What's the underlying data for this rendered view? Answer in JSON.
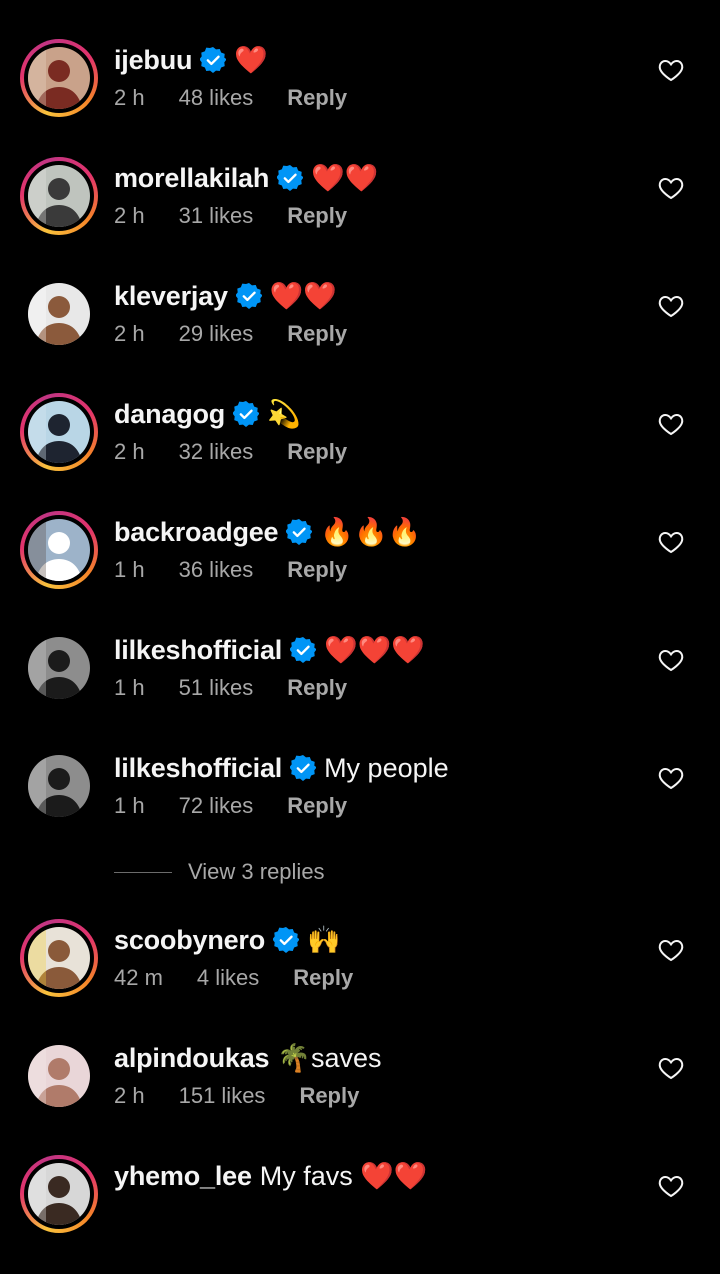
{
  "comments": [
    {
      "username": "ijebuu",
      "verified": true,
      "text": "❤️",
      "time": "2 h",
      "likes": "48 likes",
      "reply": "Reply",
      "story_ring": true,
      "avatar_colors": [
        "#c9a28a",
        "#7a2b22",
        "#e8d7c4"
      ]
    },
    {
      "username": "morellakilah",
      "verified": true,
      "text": "❤️❤️",
      "time": "2 h",
      "likes": "31 likes",
      "reply": "Reply",
      "story_ring": true,
      "avatar_colors": [
        "#bfc4be",
        "#3a3a3a",
        "#e6e6e2"
      ]
    },
    {
      "username": "kleverjay",
      "verified": true,
      "text": "❤️❤️",
      "time": "2 h",
      "likes": "29 likes",
      "reply": "Reply",
      "story_ring": false,
      "avatar_colors": [
        "#e8e8e8",
        "#8b5a3c",
        "#ffffff"
      ]
    },
    {
      "username": "danagog",
      "verified": true,
      "text": "💫",
      "time": "2 h",
      "likes": "32 likes",
      "reply": "Reply",
      "story_ring": true,
      "avatar_colors": [
        "#b9d6e6",
        "#1e2430",
        "#dbe9f2"
      ]
    },
    {
      "username": "backroadgee",
      "verified": true,
      "text": "🔥🔥🔥",
      "time": "1 h",
      "likes": "36 likes",
      "reply": "Reply",
      "story_ring": true,
      "avatar_colors": [
        "#9db3c9",
        "#ffffff",
        "#5b4c44"
      ]
    },
    {
      "username": "lilkeshofficial",
      "verified": true,
      "text": "❤️❤️❤️",
      "time": "1 h",
      "likes": "51 likes",
      "reply": "Reply",
      "story_ring": false,
      "avatar_colors": [
        "#8d8d8d",
        "#1b1b1b",
        "#cfcfcf"
      ]
    },
    {
      "username": "lilkeshofficial",
      "verified": true,
      "text": "My people",
      "time": "1 h",
      "likes": "72 likes",
      "reply": "Reply",
      "story_ring": false,
      "avatar_colors": [
        "#8d8d8d",
        "#1b1b1b",
        "#cfcfcf"
      ]
    },
    {
      "username": "scoobynero",
      "verified": true,
      "text": "🙌",
      "time": "42 m",
      "likes": "4 likes",
      "reply": "Reply",
      "story_ring": true,
      "avatar_colors": [
        "#e8e2d8",
        "#8a5a3a",
        "#f3d23c"
      ]
    },
    {
      "username": "alpindoukas",
      "verified": false,
      "text": "🌴saves",
      "time": "2 h",
      "likes": "151 likes",
      "reply": "Reply",
      "story_ring": false,
      "avatar_colors": [
        "#e9d6d8",
        "#b07b6a",
        "#f5ecec"
      ]
    },
    {
      "username": "yhemo_lee",
      "verified": false,
      "text": "My favs ❤️❤️",
      "time": "",
      "likes": "",
      "reply": "",
      "story_ring": true,
      "avatar_colors": [
        "#d7d7d7",
        "#3a2a22",
        "#efefef"
      ]
    }
  ],
  "view_replies": "View 3 replies",
  "icons": {
    "verified": "verified-badge-icon",
    "like": "heart-outline-icon"
  },
  "colors": {
    "background": "#000000",
    "verified": "#0095f6",
    "meta_text": "#a8a8a8"
  }
}
